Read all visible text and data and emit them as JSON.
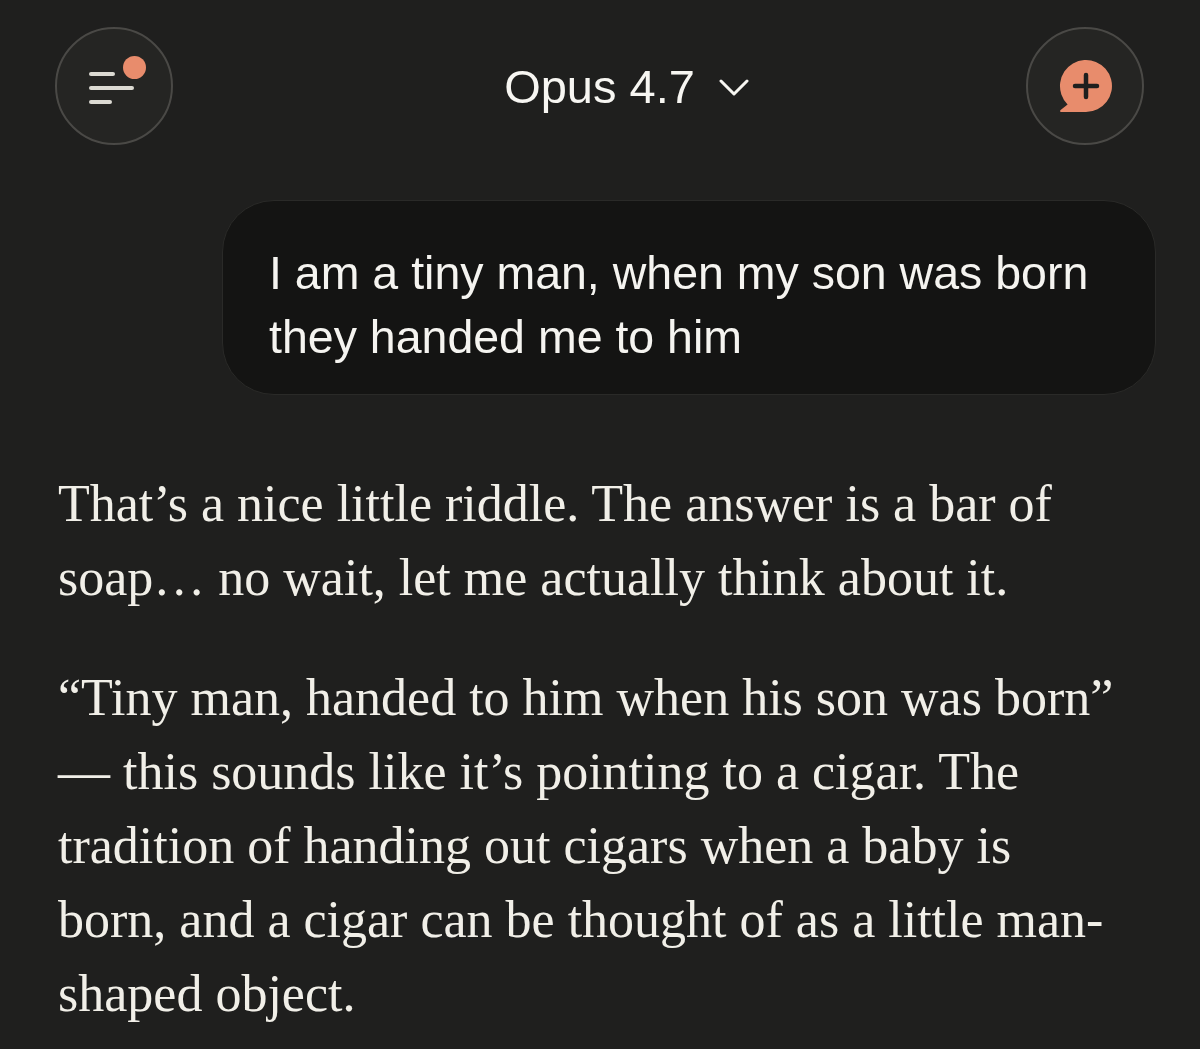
{
  "header": {
    "menu": {
      "notification": true
    },
    "model_selector": {
      "label": "Opus 4.7"
    }
  },
  "messages": [
    {
      "kind": "user",
      "text": "I am a tiny man, when my son was born they handed me to him"
    },
    {
      "kind": "assistant",
      "paragraphs": [
        "That’s a nice little riddle. The answer is a bar of soap… no wait, let me actually think about it.",
        "“Tiny man, handed to him when his son was born” — this sounds like it’s pointing to a cigar. The tradition of handing out cigars when a baby is born, and a cigar can be thought of as a little man-shaped object."
      ]
    }
  ]
}
